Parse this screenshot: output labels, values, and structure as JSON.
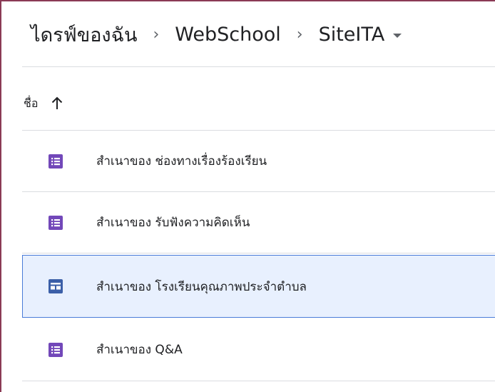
{
  "breadcrumb": {
    "items": [
      "ไดรฟ์ของฉัน",
      "WebSchool",
      "SiteITA"
    ],
    "separator": "›"
  },
  "table_header": {
    "name_label": "ชื่อ",
    "sort_icon": "arrow-up-icon",
    "sort_direction": "ascending"
  },
  "files": [
    {
      "name": "สำเนาของ ช่องทางเรื่องร้องเรียน",
      "icon": "google-forms-icon",
      "selected": false
    },
    {
      "name": "สำเนาของ รับฟังความคิดเห็น",
      "icon": "google-forms-icon",
      "selected": false
    },
    {
      "name": "สำเนาของ โรงเรียนคุณภาพประจำตำบล",
      "icon": "google-forms-icon",
      "selected": true
    },
    {
      "name": "สำเนาของ Q&A",
      "icon": "google-forms-icon",
      "selected": false
    }
  ],
  "colors": {
    "forms_icon": "#7248b9",
    "forms_icon_selected": "#3b5fa8",
    "selected_background": "#e8f0fe",
    "selected_border": "#4a7bd8",
    "divider": "#dadce0"
  }
}
